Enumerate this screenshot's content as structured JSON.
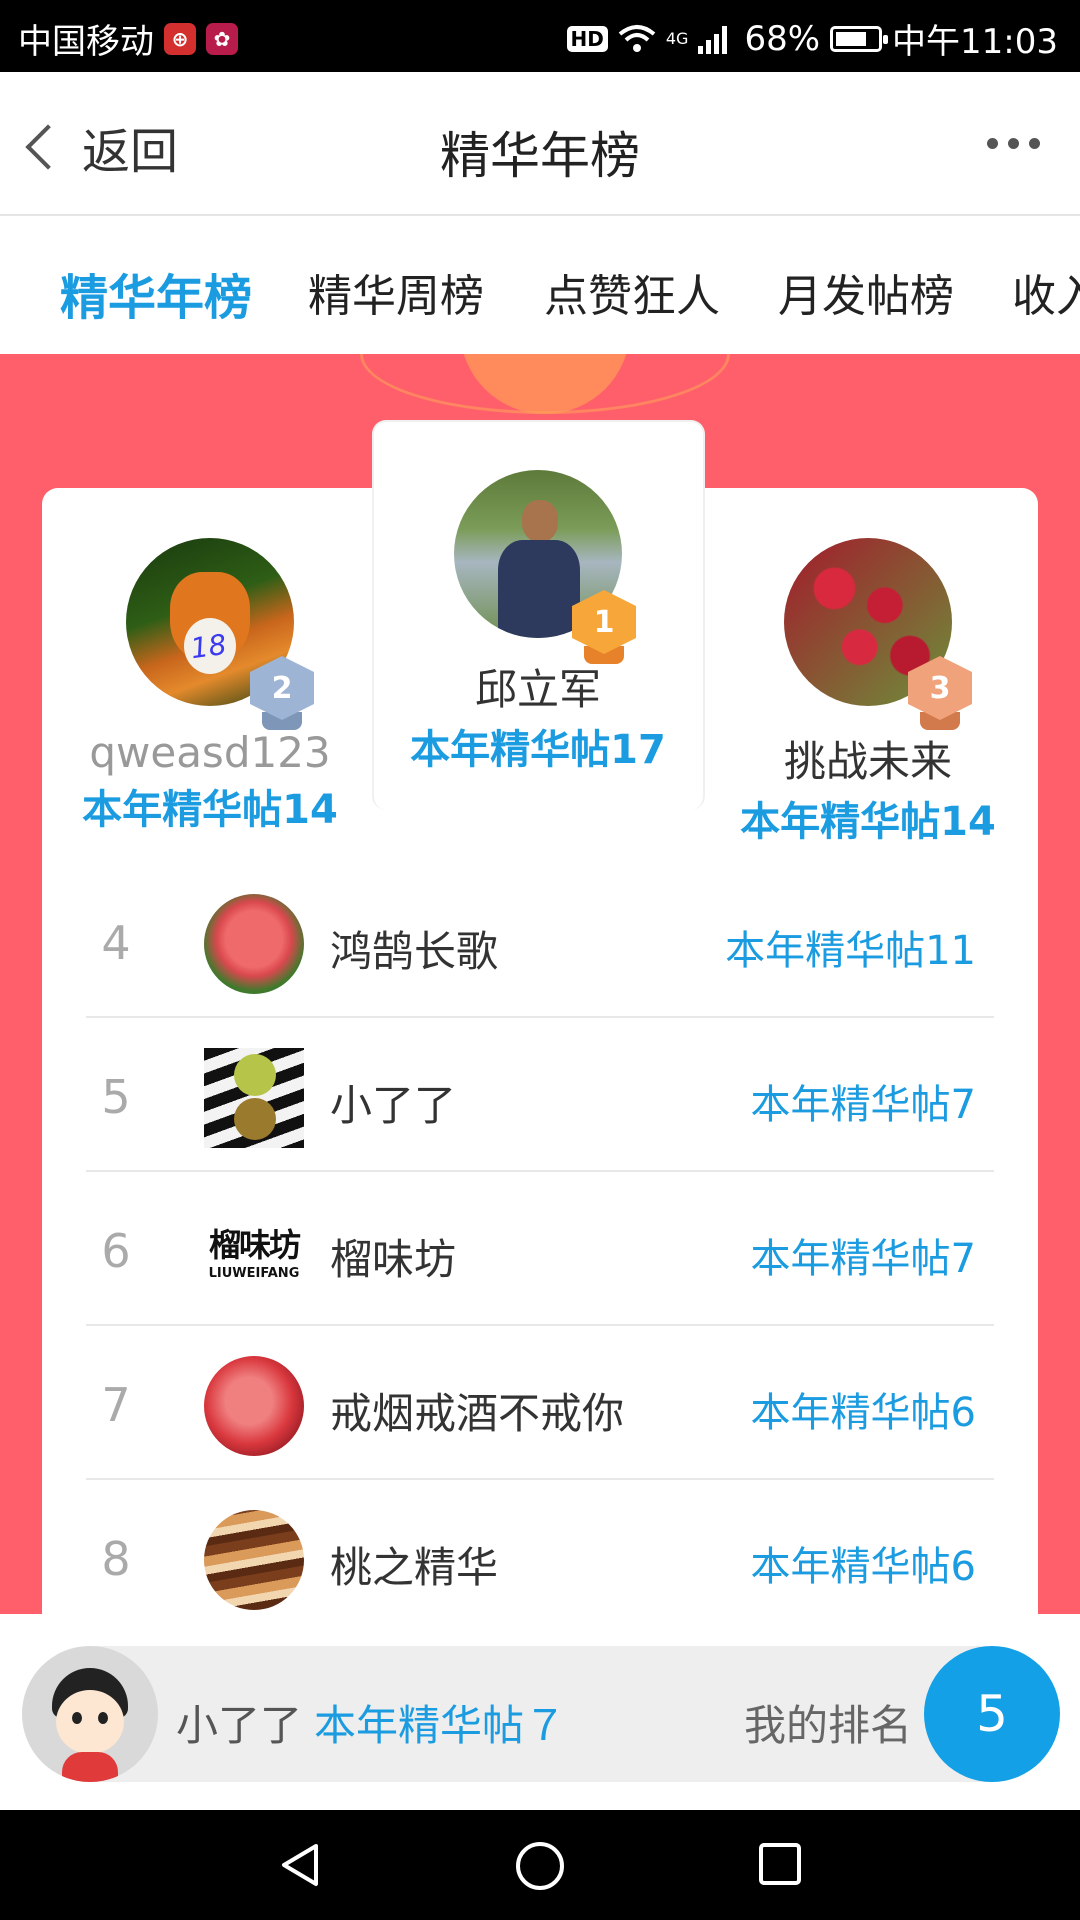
{
  "status_bar": {
    "carrier": "中国移动",
    "hd": "HD",
    "network": "4G",
    "battery": "68%",
    "battery_level": 0.68,
    "time": "中午11:03"
  },
  "nav": {
    "back_label": "返回",
    "title": "精华年榜"
  },
  "tabs": [
    {
      "label": "精华年榜",
      "active": true
    },
    {
      "label": "精华周榜",
      "active": false
    },
    {
      "label": "点赞狂人",
      "active": false
    },
    {
      "label": "月发帖榜",
      "active": false
    },
    {
      "label": "收入",
      "active": false
    }
  ],
  "podium": {
    "first": {
      "rank": "1",
      "name": "邱立军",
      "count": "本年精华帖17",
      "avatar": "man-avatar"
    },
    "second": {
      "rank": "2",
      "name": "qweasd123",
      "count": "本年精华帖14",
      "avatar": "fox-avatar"
    },
    "third": {
      "rank": "3",
      "name": "挑战未来",
      "count": "本年精华帖14",
      "avatar": "cherries-avatar"
    }
  },
  "list": [
    {
      "rank": "4",
      "name": "鸿鹄长歌",
      "count": "本年精华帖11",
      "avatar": "peach-avatar"
    },
    {
      "rank": "5",
      "name": "小了了",
      "count": "本年精华帖7",
      "avatar": "fruit-avatar"
    },
    {
      "rank": "6",
      "name": "榴味坊",
      "count": "本年精华帖7",
      "avatar": "liuweifang-logo-avatar",
      "logo_text": "榴味坊",
      "logo_sub": "LIUWEIFANG"
    },
    {
      "rank": "7",
      "name": "戒烟戒酒不戒你",
      "count": "本年精华帖6",
      "avatar": "peach-avatar"
    },
    {
      "rank": "8",
      "name": "桃之精华",
      "count": "本年精华帖6",
      "avatar": "jupiter-avatar"
    }
  ],
  "my": {
    "name": "小了了",
    "count": "本年精华帖７",
    "rank_label": "我的排名",
    "rank": "5"
  },
  "colors": {
    "accent": "#1b9be0",
    "hero": "#ff5f6a"
  }
}
